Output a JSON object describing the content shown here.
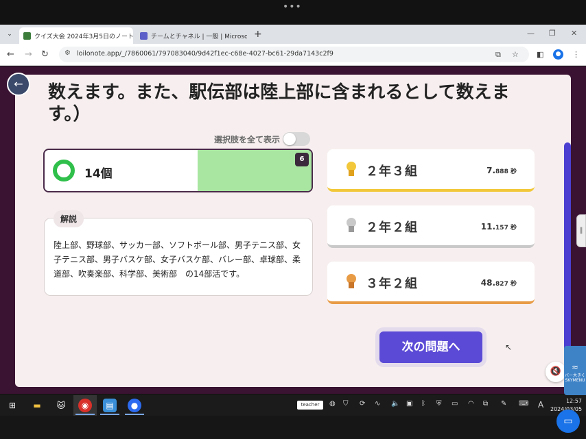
{
  "system": {
    "dots": "•••"
  },
  "browser": {
    "tabs": [
      {
        "label": "クイズ大会 2024年3月5日のノート",
        "favicon_color": "#3c7d3c"
      },
      {
        "label": "チームとチャネル | 一般 | Microsoft",
        "favicon_color": "#5b5fc7"
      }
    ],
    "url": "loilonote.app/_/7860061/797083040/9d42f1ec-c68e-4027-bc61-29da7143c2f9"
  },
  "quiz": {
    "question_text": "数えます。また、駅伝部は陸上部に含まれるとして数えます。）",
    "show_all_label": "選択肢を全て表示",
    "show_all_enabled": false,
    "answer": {
      "text": "14個",
      "count": "6",
      "fill_fraction": 0.43
    },
    "explanation_label": "解説",
    "explanation_text": "陸上部、野球部、サッカー部、ソフトボール部、男子テニス部、女子テニス部、男子バスケ部、女子バスケ部、バレー部、卓球部、柔道部、吹奏楽部、科学部、美術部　の14部活です。",
    "rankings": [
      {
        "name": "２年３組",
        "time_int": "7.",
        "time_dec": "888",
        "unit": "秒",
        "color": "#f2c83a",
        "ribbon": "#e0a21d"
      },
      {
        "name": "２年２組",
        "time_int": "11.",
        "time_dec": "157",
        "unit": "秒",
        "color": "#c9c9c9",
        "ribbon": "#9a9a9a"
      },
      {
        "name": "３年２組",
        "time_int": "48.",
        "time_dec": "827",
        "unit": "秒",
        "color": "#e89b45",
        "ribbon": "#c9762a"
      }
    ],
    "next_button": "次の問題へ"
  },
  "side": {
    "sky_menu_label": "バー大きく",
    "sky_menu_brand": "SKYMENU"
  },
  "taskbar": {
    "teacher_label": "teacher",
    "time": "12:57",
    "date": "2024/03/05"
  }
}
